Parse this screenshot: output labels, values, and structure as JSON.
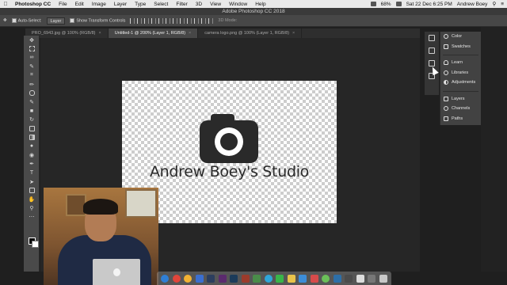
{
  "menubar": {
    "app_name": "Photoshop CC",
    "items": [
      "File",
      "Edit",
      "Image",
      "Layer",
      "Type",
      "Select",
      "Filter",
      "3D",
      "View",
      "Window",
      "Help"
    ],
    "battery": "68%",
    "datetime": "Sat 22 Dec  6:25 PM",
    "user": "Andrew Boey"
  },
  "window": {
    "title": "Adobe Photoshop CC 2018"
  },
  "options": {
    "auto_select_label": "Auto-Select:",
    "auto_select_value": "Layer",
    "show_transform_label": "Show Transform Controls",
    "mode_label": "3D Mode:"
  },
  "tabs": [
    {
      "label": "PRO_6943.jpg @ 100% (RGB/8)",
      "active": false
    },
    {
      "label": "Untitled-1 @ 200% (Layer 1, RGB/8)",
      "active": true
    },
    {
      "label": "camera logo.png @ 100% (Layer 1, RGB/8)",
      "active": false
    }
  ],
  "canvas": {
    "logo_text": "Andrew Boey's Studio"
  },
  "panels": [
    {
      "label": "Color",
      "icon": "color-wheel-icon"
    },
    {
      "label": "Swatches",
      "icon": "swatches-grid-icon"
    },
    {
      "label": "Learn",
      "icon": "lightbulb-icon"
    },
    {
      "label": "Libraries",
      "icon": "cloud-libraries-icon"
    },
    {
      "label": "Adjustments",
      "icon": "adjustments-circle-icon"
    },
    {
      "label": "Layers",
      "icon": "layers-stack-icon"
    },
    {
      "label": "Channels",
      "icon": "channels-icon"
    },
    {
      "label": "Paths",
      "icon": "paths-icon"
    }
  ],
  "colors": {
    "workspace": "#262626",
    "panel": "#424242",
    "logo": "#2a2a2a"
  }
}
